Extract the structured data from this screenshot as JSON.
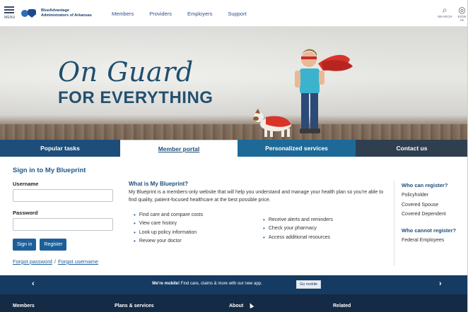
{
  "header": {
    "menu_label": "MENU",
    "logo_line1": "BlueAdvantage",
    "logo_line2": "Administrators of Arkansas",
    "nav": [
      "Members",
      "Providers",
      "Employers",
      "Support"
    ],
    "search_label": "SEARCH",
    "sign_in_label": "SIGN IN"
  },
  "hero": {
    "headline": "On Guard",
    "subheadline": "FOR EVERYTHING"
  },
  "tabs": [
    "Popular tasks",
    "Member portal",
    "Personalized services",
    "Contact us"
  ],
  "signin": {
    "title": "Sign in to My Blueprint",
    "username_label": "Username",
    "password_label": "Password",
    "signin_button": "Sign in",
    "register_button": "Register",
    "forgot_password": "Forgot password",
    "separator": "/",
    "forgot_username": "Forgot username"
  },
  "info": {
    "title": "What is My Blueprint?",
    "description": "My Blueprint is a members-only website that will help you understand and manage your health plan so you're able to find quality, patient-focused healthcare at the best possible price.",
    "bullets_left": [
      "Find care and compare costs",
      "View care history",
      "Look up policy information",
      "Review your doctor"
    ],
    "bullets_right": [
      "Receive alerts and reminders",
      "Check your pharmacy",
      "Access additional resources"
    ]
  },
  "side": {
    "can_title": "Who can register?",
    "can_items": [
      "Policyholder",
      "Covered Spouse",
      "Covered Dependent"
    ],
    "cannot_title": "Who cannot register?",
    "cannot_items": [
      "Federal Employees"
    ]
  },
  "band": {
    "prev": "‹",
    "next": "›",
    "bold": "We're mobile!",
    "message": "Find care, claims & more with our new app.",
    "button": "Go mobile"
  },
  "footer": {
    "columns": [
      "Members",
      "Plans & services",
      "About",
      "Related"
    ]
  },
  "colors": {
    "brand_blue": "#1d4e7a",
    "accent_blue": "#1d5f99",
    "band": "#163b63",
    "footer": "#142a45"
  }
}
